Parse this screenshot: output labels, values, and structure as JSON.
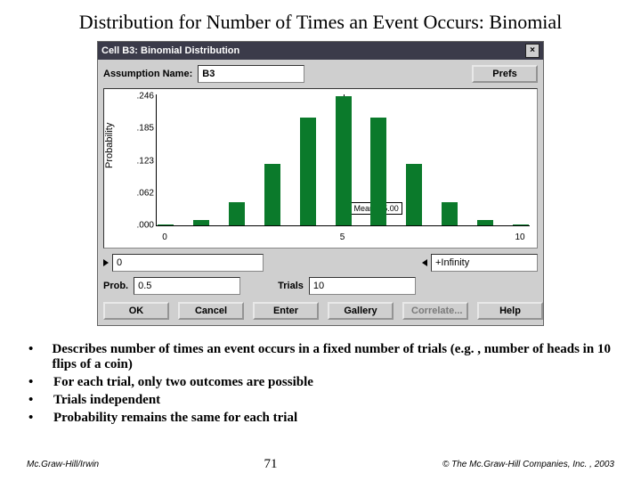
{
  "title": "Distribution for Number of Times an Event Occurs: Binomial",
  "dialog": {
    "titlebar": "Cell B3:  Binomial Distribution",
    "close": "×",
    "assumption": {
      "label": "Assumption Name:",
      "value": "B3"
    },
    "prefs": "Prefs",
    "ylabel": "Probability",
    "mean_label": "Mean = 5.00",
    "range": {
      "low": "0",
      "high": "+Infinity"
    },
    "prob": {
      "label": "Prob.",
      "value": "0.5"
    },
    "trials": {
      "label": "Trials",
      "value": "10"
    },
    "buttons": {
      "ok": "OK",
      "cancel": "Cancel",
      "enter": "Enter",
      "gallery": "Gallery",
      "correlate": "Correlate...",
      "help": "Help"
    }
  },
  "chart_data": {
    "type": "bar",
    "categories": [
      0,
      1,
      2,
      3,
      4,
      5,
      6,
      7,
      8,
      9,
      10
    ],
    "values": [
      0.001,
      0.01,
      0.044,
      0.117,
      0.205,
      0.246,
      0.205,
      0.117,
      0.044,
      0.01,
      0.001
    ],
    "ylabel": "Probability",
    "ylim": [
      0,
      0.25
    ],
    "yticks": [
      0.0,
      0.062,
      0.123,
      0.185,
      0.246
    ],
    "ytick_labels": [
      ".000",
      ".062",
      ".123",
      ".185",
      ".246"
    ],
    "xlim": [
      0,
      10
    ],
    "xtick_labels": [
      "0",
      "5",
      "10"
    ],
    "mean": 5.0,
    "mean_text": "Mean = 5.00"
  },
  "bullets": [
    "Describes number of times an event occurs in a fixed number of trials (e.g. , number of heads in 10 flips of a coin)",
    "For each trial, only two outcomes are possible",
    "Trials independent",
    "Probability remains the same for each trial"
  ],
  "footer": {
    "left": "Mc.Graw-Hill/Irwin",
    "page": "71",
    "right": "© The Mc.Graw-Hill Companies, Inc. , 2003"
  }
}
